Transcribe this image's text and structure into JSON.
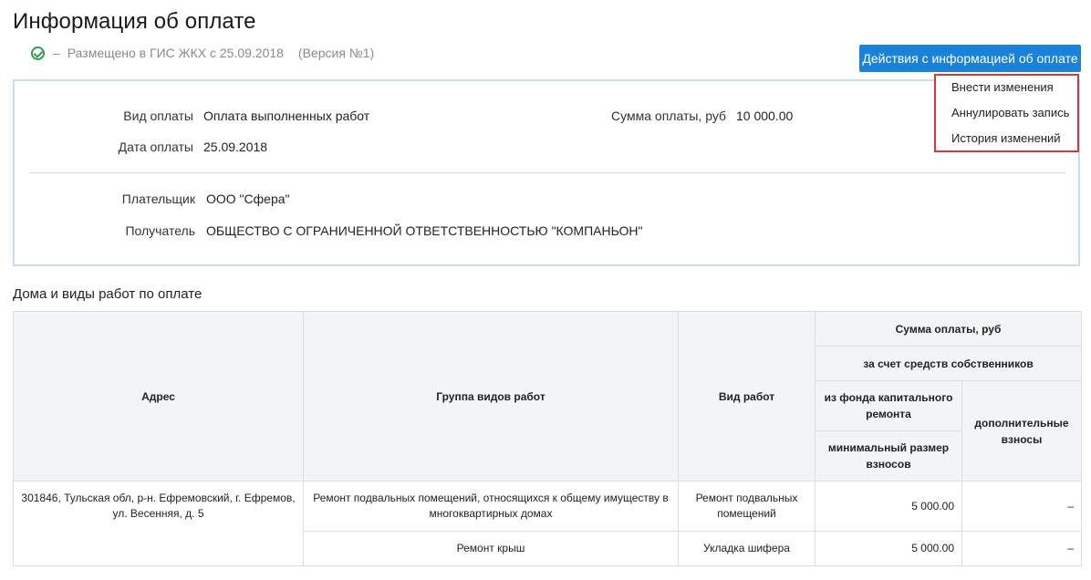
{
  "page": {
    "title": "Информация об оплате",
    "status_dash": "–",
    "status_text": "Размещено в ГИС ЖКХ с 25.09.2018",
    "version": "(Версия №1)"
  },
  "actions": {
    "button_label": "Действия с информацией об оплате",
    "menu": [
      "Внести изменения",
      "Аннулировать запись",
      "История изменений"
    ]
  },
  "details": {
    "payment_type_label": "Вид оплаты",
    "payment_type_value": "Оплата выполненных работ",
    "payment_date_label": "Дата оплаты",
    "payment_date_value": "25.09.2018",
    "amount_label": "Сумма оплаты, руб",
    "amount_value": "10 000.00",
    "payer_label": "Плательщик",
    "payer_value": "ООО \"Сфера\"",
    "recipient_label": "Получатель",
    "recipient_value": "ОБЩЕСТВО С ОГРАНИЧЕННОЙ ОТВЕТСТВЕННОСТЬЮ \"КОМПАНЬОН\""
  },
  "works": {
    "section_title": "Дома и виды работ по оплате",
    "headers": {
      "address": "Адрес",
      "group": "Группа видов работ",
      "type": "Вид работ",
      "amount": "Сумма оплаты, руб",
      "owners_funds": "за счет средств собственников",
      "capital_fund": "из фонда капитального ремонта",
      "additional": "дополнительные взносы",
      "min_contribution": "минимальный размер взносов"
    },
    "address": "301846, Тульская обл, р-н. Ефремовский, г. Ефремов, ул. Весенняя, д. 5",
    "rows": [
      {
        "group": "Ремонт подвальных помещений, относящихся к общему имуществу в многоквартирных домах",
        "type": "Ремонт подвальных помещений",
        "min": "5 000.00",
        "additional": "–"
      },
      {
        "group": "Ремонт крыш",
        "type": "Укладка шифера",
        "min": "5 000.00",
        "additional": "–"
      }
    ]
  },
  "colors": {
    "accent": "#1a82d8",
    "success": "#2e9e4b",
    "highlight": "#d9363a",
    "card_border": "#c4dff3"
  }
}
